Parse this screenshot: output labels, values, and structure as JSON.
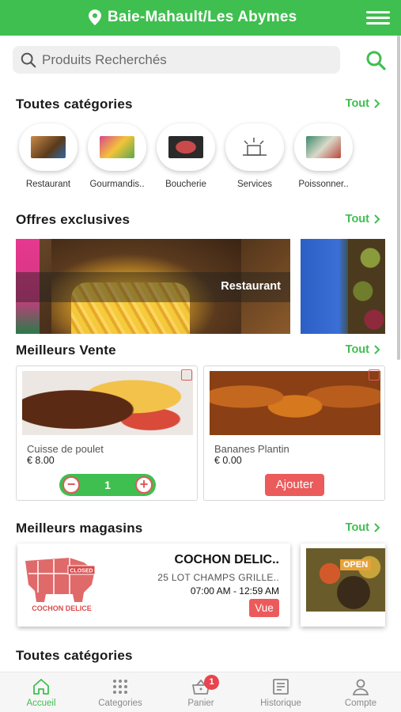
{
  "header": {
    "location": "Baie-Mahault/Les Abymes"
  },
  "search": {
    "placeholder": "Produits Recherchés"
  },
  "categories_section": {
    "title": "Toutes catégories",
    "link": "Tout"
  },
  "categories": [
    {
      "label": "Restaurant",
      "color": "#b7794a"
    },
    {
      "label": "Gourmandis..",
      "color": "#d9488b"
    },
    {
      "label": "Boucherie",
      "color": "#a83a3a"
    },
    {
      "label": "Services",
      "color": "#6e6e6e"
    },
    {
      "label": "Poissonner..",
      "color": "#3a8a6a"
    }
  ],
  "offers_section": {
    "title": "Offres exclusives",
    "link": "Tout"
  },
  "offers": [
    {
      "label": "Restaurant"
    }
  ],
  "best_sellers_section": {
    "title": "Meilleurs Vente",
    "link": "Tout"
  },
  "products": [
    {
      "name": "Cuisse de poulet",
      "price": "€ 8.00",
      "quantity": "1"
    },
    {
      "name": "Bananes Plantin",
      "price": "€ 0.00",
      "add_label": "Ajouter"
    }
  ],
  "stores_section": {
    "title": "Meilleurs magasins",
    "link": "Tout"
  },
  "stores": [
    {
      "name": "COCHON DELIC..",
      "address": "25 LOT CHAMPS GRILLE..",
      "hours": "07:00 AM - 12:59 AM",
      "view_label": "Vue",
      "logo_text": "COCHON DELICE",
      "status": "CLOSED"
    },
    {
      "status": "OPEN"
    }
  ],
  "bottom_section": {
    "title": "Toutes catégories"
  },
  "bottom_nav": [
    {
      "label": "Accueil"
    },
    {
      "label": "Categories"
    },
    {
      "label": "Panier",
      "badge": "1"
    },
    {
      "label": "Historique"
    },
    {
      "label": "Compte"
    }
  ],
  "colors": {
    "primary": "#3fbf4f",
    "accent": "#ec5b5b"
  }
}
